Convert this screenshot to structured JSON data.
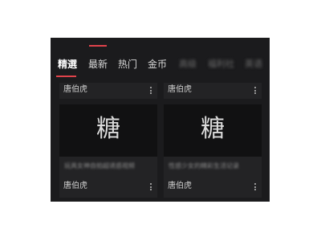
{
  "tabs": [
    {
      "label": "精選",
      "active": true
    },
    {
      "label": "最新"
    },
    {
      "label": "热门"
    },
    {
      "label": "金币"
    },
    {
      "label": "高级",
      "blurred": true
    },
    {
      "label": "福利社",
      "blurred": true
    },
    {
      "label": "英语",
      "blurred": true
    }
  ],
  "top_cards": [
    {
      "author": "唐伯虎"
    },
    {
      "author": "唐伯虎"
    }
  ],
  "cards": [
    {
      "logo_text": "糖",
      "title": "玩具女神自拍超诱惑视频",
      "author": "唐伯虎"
    },
    {
      "logo_text": "糖",
      "title": "性感少女的精彩生活记录",
      "author": "唐伯虎"
    }
  ],
  "colors": {
    "accent": "#e0434b",
    "background": "#1b1b1d",
    "card": "#232325"
  }
}
